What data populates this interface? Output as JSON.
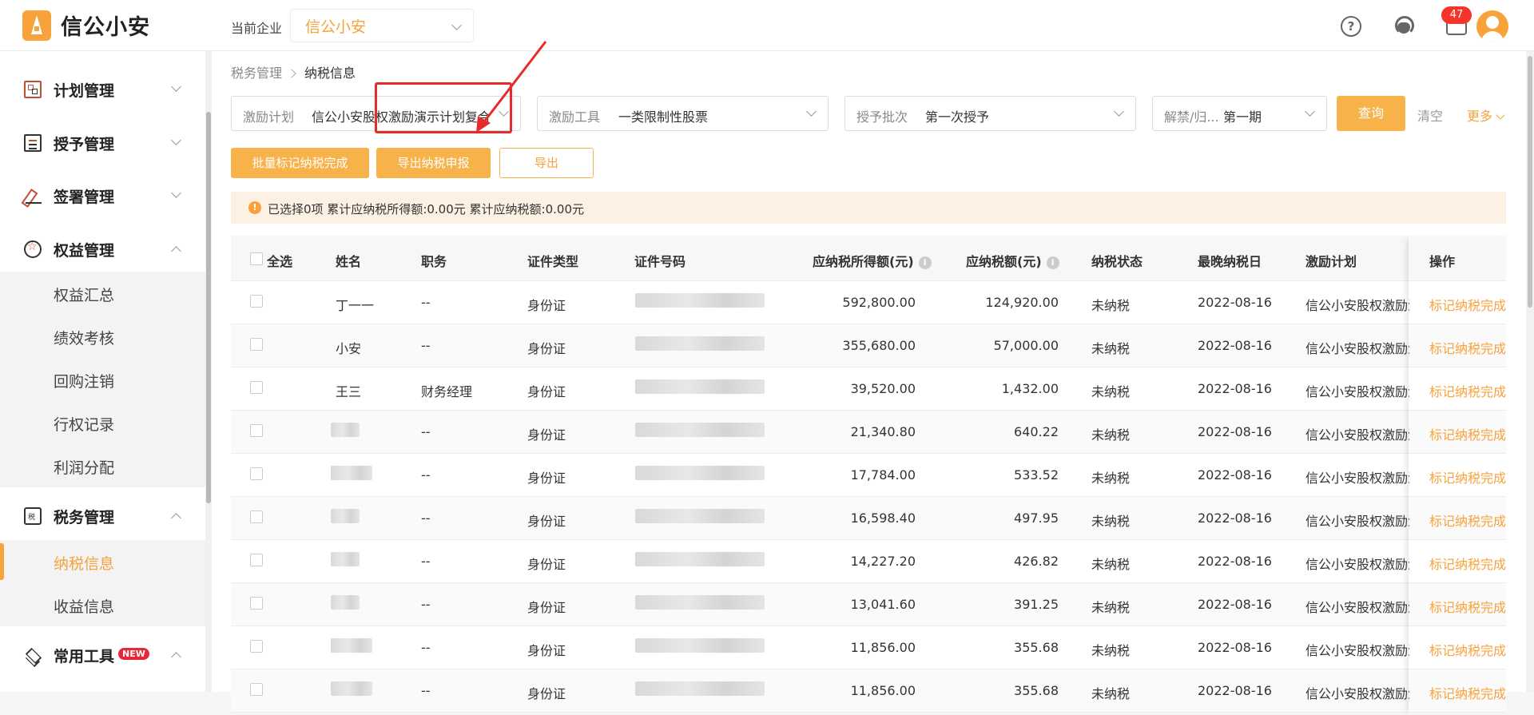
{
  "app": {
    "name": "信公小安"
  },
  "header": {
    "company_label": "当前企业",
    "company_value": "信公小安",
    "message_count": "47"
  },
  "sidebar": {
    "groups": [
      {
        "label": "计划管理",
        "icon": "plan-icon",
        "expanded": false
      },
      {
        "label": "授予管理",
        "icon": "grant-icon",
        "expanded": false
      },
      {
        "label": "签署管理",
        "icon": "sign-icon",
        "expanded": false
      },
      {
        "label": "权益管理",
        "icon": "equity-icon",
        "expanded": true,
        "items": [
          "权益汇总",
          "绩效考核",
          "回购注销",
          "行权记录",
          "利润分配"
        ]
      },
      {
        "label": "税务管理",
        "icon": "tax-icon",
        "expanded": true,
        "items": [
          "纳税信息",
          "收益信息"
        ],
        "active_item": "纳税信息"
      },
      {
        "label": "常用工具",
        "icon": "tools-icon",
        "expanded": true,
        "badge": "NEW"
      }
    ]
  },
  "breadcrumb": {
    "root": "税务管理",
    "current": "纳税信息"
  },
  "filters": {
    "incentive_plan": {
      "label": "激励计划",
      "value": "信公小安股权激励演示计划复合"
    },
    "incentive_tool": {
      "label": "激励工具",
      "value": "一类限制性股票"
    },
    "grant_batch": {
      "label": "授予批次",
      "value": "第一次授予"
    },
    "unlock_period": {
      "label": "解禁/归...",
      "value": "第一期"
    },
    "query_label": "查询",
    "clear_label": "清空",
    "more_label": "更多"
  },
  "actions": {
    "batch_mark_label": "批量标记纳税完成",
    "export_declaration_label": "导出纳税申报",
    "export_label": "导出"
  },
  "notice": {
    "text": "已选择0项 累计应纳税所得额:0.00元 累计应纳税额:0.00元"
  },
  "table": {
    "headers": {
      "select_all": "全选",
      "name": "姓名",
      "position": "职务",
      "id_type": "证件类型",
      "id_number": "证件号码",
      "taxable_income": "应纳税所得额(元)",
      "tax_amount": "应纳税额(元)",
      "tax_status": "纳税状态",
      "deadline": "最晚纳税日",
      "plan": "激励计划",
      "operation": "操作"
    },
    "rows": [
      {
        "name": "丁一一",
        "position": "--",
        "id_type": "身份证",
        "taxable_income": "592,800.00",
        "tax_amount": "124,920.00",
        "tax_status": "未纳税",
        "deadline": "2022-08-16",
        "plan": "信公小安股权激励演示计划复合",
        "operation": "标记纳税完成"
      },
      {
        "name": "小安",
        "position": "--",
        "id_type": "身份证",
        "taxable_income": "355,680.00",
        "tax_amount": "57,000.00",
        "tax_status": "未纳税",
        "deadline": "2022-08-16",
        "plan": "信公小安股权激励演示计划复合",
        "operation": "标记纳税完成"
      },
      {
        "name": "王三",
        "position": "财务经理",
        "id_type": "身份证",
        "taxable_income": "39,520.00",
        "tax_amount": "1,432.00",
        "tax_status": "未纳税",
        "deadline": "2022-08-16",
        "plan": "信公小安股权激励演示计划复合",
        "operation": "标记纳税完成"
      },
      {
        "name": "",
        "position": "--",
        "id_type": "身份证",
        "taxable_income": "21,340.80",
        "tax_amount": "640.22",
        "tax_status": "未纳税",
        "deadline": "2022-08-16",
        "plan": "信公小安股权激励演示计划复合",
        "operation": "标记纳税完成"
      },
      {
        "name": "",
        "position": "--",
        "id_type": "身份证",
        "taxable_income": "17,784.00",
        "tax_amount": "533.52",
        "tax_status": "未纳税",
        "deadline": "2022-08-16",
        "plan": "信公小安股权激励演示计划复合",
        "operation": "标记纳税完成"
      },
      {
        "name": "",
        "position": "--",
        "id_type": "身份证",
        "taxable_income": "16,598.40",
        "tax_amount": "497.95",
        "tax_status": "未纳税",
        "deadline": "2022-08-16",
        "plan": "信公小安股权激励演示计划复合",
        "operation": "标记纳税完成"
      },
      {
        "name": "",
        "position": "--",
        "id_type": "身份证",
        "taxable_income": "14,227.20",
        "tax_amount": "426.82",
        "tax_status": "未纳税",
        "deadline": "2022-08-16",
        "plan": "信公小安股权激励演示计划复合",
        "operation": "标记纳税完成"
      },
      {
        "name": "",
        "position": "--",
        "id_type": "身份证",
        "taxable_income": "13,041.60",
        "tax_amount": "391.25",
        "tax_status": "未纳税",
        "deadline": "2022-08-16",
        "plan": "信公小安股权激励演示计划复合",
        "operation": "标记纳税完成"
      },
      {
        "name": "",
        "position": "--",
        "id_type": "身份证",
        "taxable_income": "11,856.00",
        "tax_amount": "355.68",
        "tax_status": "未纳税",
        "deadline": "2022-08-16",
        "plan": "信公小安股权激励演示计划复合",
        "operation": "标记纳税完成"
      },
      {
        "name": "",
        "position": "--",
        "id_type": "身份证",
        "taxable_income": "11,856.00",
        "tax_amount": "355.68",
        "tax_status": "未纳税",
        "deadline": "2022-08-16",
        "plan": "信公小安股权激励演示计划复合",
        "operation": "标记纳税完成"
      }
    ]
  },
  "colors": {
    "accent": "#f7a23b",
    "highlight": "#e62b2b"
  }
}
